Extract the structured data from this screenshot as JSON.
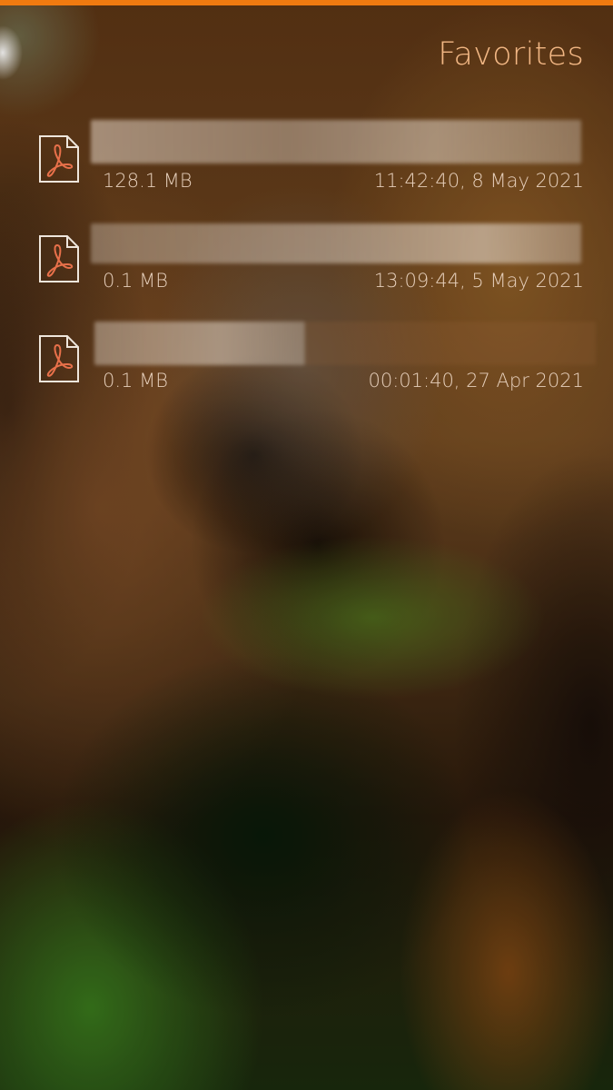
{
  "theme": {
    "accent": "#f07a10",
    "title_color": "#f2b784",
    "text_color": "#e6cfbb"
  },
  "header": {
    "title": "Favorites"
  },
  "files": [
    {
      "icon": "pdf-icon",
      "name": "",
      "size": "128.1 MB",
      "date": "11:42:40, 8 May 2021"
    },
    {
      "icon": "pdf-icon",
      "name": "",
      "size": "0.1 MB",
      "date": "13:09:44, 5 May 2021"
    },
    {
      "icon": "pdf-icon",
      "name": "",
      "size": "0.1 MB",
      "date": "00:01:40, 27 Apr 2021"
    }
  ]
}
